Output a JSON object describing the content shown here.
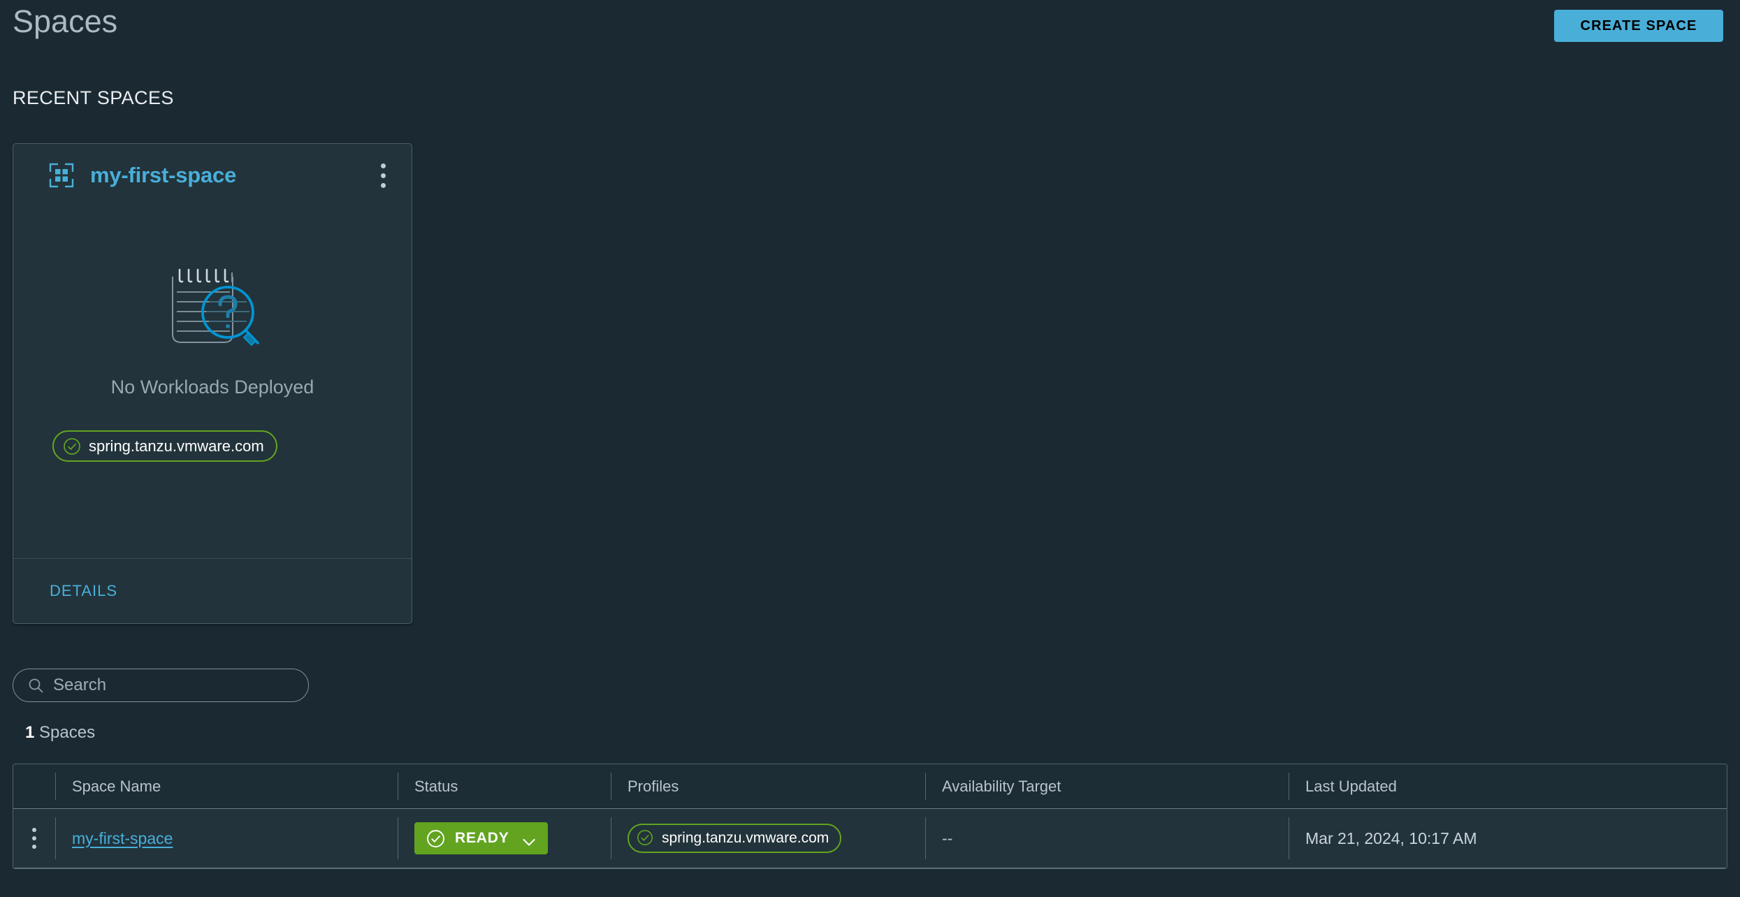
{
  "header": {
    "title": "Spaces",
    "create_button": "CREATE SPACE"
  },
  "section": {
    "recent_label": "RECENT SPACES"
  },
  "card": {
    "title": "my-first-space",
    "icon": "space-grid-icon",
    "menu_icon": "kebab-menu-icon",
    "empty_illustration": "no-workloads-magnifier-icon",
    "empty_text": "No Workloads Deployed",
    "profile": "spring.tanzu.vmware.com",
    "profile_status_icon": "check-circle-icon",
    "details_label": "DETAILS"
  },
  "search": {
    "placeholder": "Search",
    "value": "",
    "icon": "search-icon"
  },
  "summary": {
    "count": "1",
    "label": "Spaces"
  },
  "table": {
    "columns": [
      "",
      "Space Name",
      "Status",
      "Profiles",
      "Availability Target",
      "Last Updated"
    ],
    "rows": [
      {
        "menu_icon": "kebab-menu-icon",
        "space_name": "my-first-space",
        "status": "READY",
        "status_icon": "check-circle-icon",
        "status_caret": "chevron-down-icon",
        "profile": "spring.tanzu.vmware.com",
        "profile_icon": "check-circle-icon",
        "availability_target": "--",
        "last_updated": "Mar 21, 2024, 10:17 AM"
      }
    ]
  },
  "colors": {
    "background": "#1b2a32",
    "card": "#22333b",
    "accent_blue": "#49afd9",
    "status_green": "#62a420",
    "text_primary": "#eaedf0",
    "text_secondary": "#b8c4cc"
  }
}
